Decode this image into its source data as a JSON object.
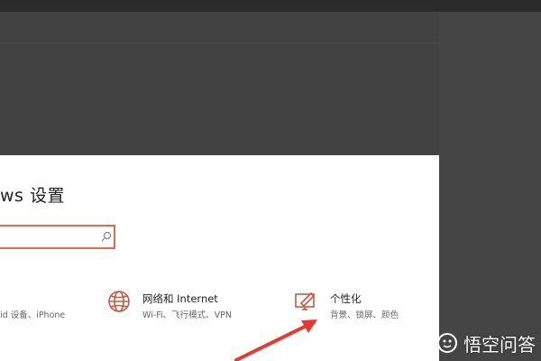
{
  "window": {
    "title": "ws 设置"
  },
  "search": {
    "placeholder": ""
  },
  "items": [
    {
      "subtitle": "id 设备、iPhone"
    },
    {
      "title": "网络和 Internet",
      "subtitle": "Wi-Fi、飞行模式、VPN",
      "icon": "globe-icon"
    },
    {
      "title": "个性化",
      "subtitle": "背景、锁屏、颜色",
      "icon": "personalization-icon"
    }
  ],
  "annotation": {
    "arrow": "red-arrow",
    "color": "#e53935"
  },
  "watermark": {
    "text": "悟空问答"
  },
  "colors": {
    "accent": "#e36a4c",
    "icon": "#c75a43"
  }
}
